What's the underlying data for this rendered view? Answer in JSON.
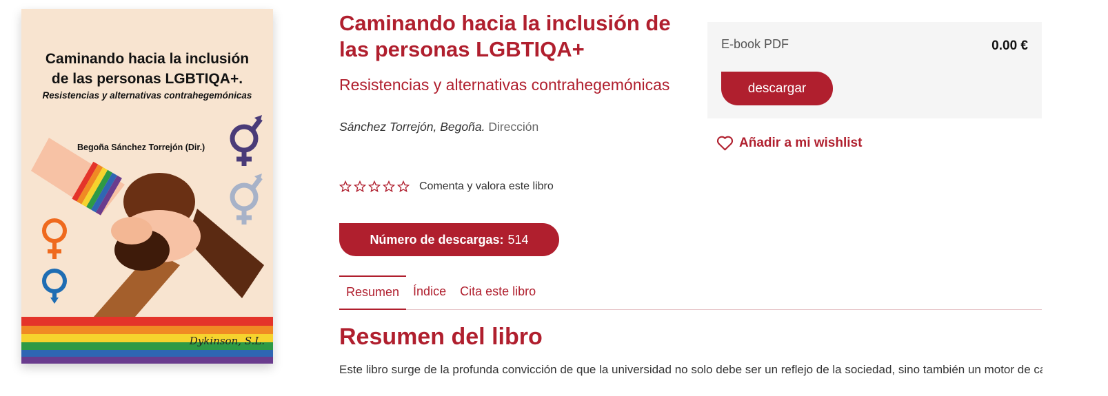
{
  "cover": {
    "title_line1": "Caminando hacia la inclusión",
    "title_line2": "de las personas LGBTIQA+.",
    "subtitle": "Resistencias y alternativas contrahegemónicas",
    "author": "Begoña Sánchez Torrejón (Dir.)",
    "publisher": "Dykinson, S.L."
  },
  "book": {
    "title": "Caminando hacia la inclusión de las personas LGBTIQA+",
    "subtitle": "Resistencias y alternativas contrahegemónicas",
    "author_name": "Sánchez Torrejón, Begoña.",
    "author_role": "Dirección"
  },
  "rating": {
    "stars_filled": 0,
    "stars_total": 5,
    "label": "Comenta y valora este libro"
  },
  "downloads": {
    "label": "Número de descargas:",
    "count": "514"
  },
  "tabs": [
    {
      "label": "Resumen",
      "active": true
    },
    {
      "label": "Índice",
      "active": false
    },
    {
      "label": "Cita este libro",
      "active": false
    }
  ],
  "summary": {
    "heading": "Resumen del libro",
    "text": "Este libro surge de la profunda convicción de que la universidad no solo debe ser un reflejo de la sociedad, sino también un motor de cambio y transformación hacia una sociedad más justa e equitativa, a dar voz y derechos de las personas LGBTIQA+ y de la calidad de..."
  },
  "purchase": {
    "format": "E-book PDF",
    "price": "0.00 €",
    "button_label": "descargar"
  },
  "wishlist": {
    "label": "Añadir a mi wishlist",
    "icon": "heart-outline-icon"
  },
  "colors": {
    "accent": "#b01f2e",
    "panel": "#f5f5f5",
    "cover_bg": "#f8e4d0"
  }
}
